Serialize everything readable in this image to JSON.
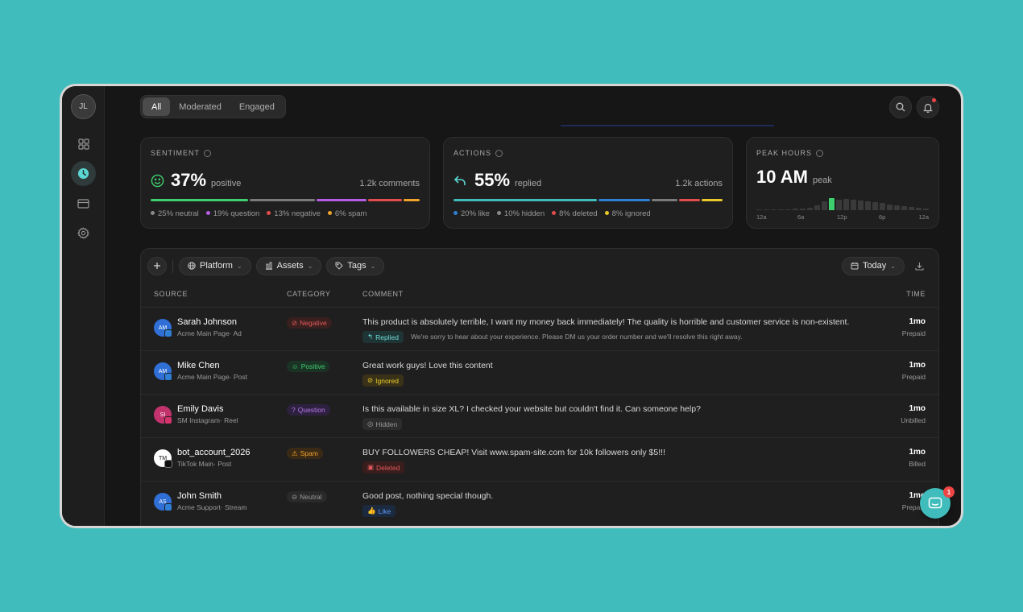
{
  "user": {
    "initials": "JL"
  },
  "sidebar": {
    "items": [
      {
        "icon": "grid-icon"
      },
      {
        "icon": "clock-icon",
        "active": true
      },
      {
        "icon": "card-icon"
      },
      {
        "icon": "gear-icon"
      }
    ]
  },
  "tabs": [
    {
      "label": "All",
      "active": true
    },
    {
      "label": "Moderated"
    },
    {
      "label": "Engaged"
    }
  ],
  "sentiment": {
    "title": "SENTIMENT",
    "value": "37%",
    "value_label": "positive",
    "count": "1.2k comments",
    "legend": [
      "25% neutral",
      "19% question",
      "13% negative",
      "6% spam"
    ]
  },
  "actions": {
    "title": "ACTIONS",
    "value": "55%",
    "value_label": "replied",
    "count": "1.2k actions",
    "legend": [
      "20% like",
      "10% hidden",
      "8% deleted",
      "8% ignored"
    ]
  },
  "peak": {
    "title": "PEAK HOURS",
    "value": "10 AM",
    "value_label": "peak",
    "axis": [
      "12a",
      "6a",
      "12p",
      "6p",
      "12a"
    ]
  },
  "toolbar": {
    "platform": "Platform",
    "assets": "Assets",
    "tags": "Tags",
    "date": "Today"
  },
  "table": {
    "headers": {
      "source": "SOURCE",
      "category": "CATEGORY",
      "comment": "COMMENT",
      "time": "TIME"
    },
    "rows": [
      {
        "initials": "AM",
        "name": "Sarah Johnson",
        "sub": "Acme Main Page· Ad",
        "category": "Negative",
        "comment": "This product is absolutely terrible, I want my money back immediately! The quality is horrible and customer service is non-existent.",
        "status": "Replied",
        "reply": "We're sorry to hear about your experience. Please DM us your order number and we'll resolve this right away.",
        "time": "1mo",
        "billing": "Prepaid"
      },
      {
        "initials": "AM",
        "name": "Mike Chen",
        "sub": "Acme Main Page· Post",
        "category": "Positive",
        "comment": "Great work guys! Love this content",
        "status": "Ignored",
        "reply": "",
        "time": "1mo",
        "billing": "Prepaid"
      },
      {
        "initials": "SI",
        "name": "Emily Davis",
        "sub": "SM Instagram· Reel",
        "category": "Question",
        "comment": "Is this available in size XL? I checked your website but couldn't find it. Can someone help?",
        "status": "Hidden",
        "reply": "",
        "time": "1mo",
        "billing": "Unbilled"
      },
      {
        "initials": "TM",
        "name": "bot_account_2026",
        "sub": "TikTok Main· Post",
        "category": "Spam",
        "comment": "BUY FOLLOWERS CHEAP! Visit www.spam-site.com for 10k followers only $5!!!",
        "status": "Deleted",
        "reply": "",
        "time": "1mo",
        "billing": "Billed"
      },
      {
        "initials": "AS",
        "name": "John Smith",
        "sub": "Acme Support· Stream",
        "category": "Neutral",
        "comment": "Good post, nothing special though.",
        "status": "Like",
        "reply": "",
        "time": "1mo",
        "billing": "Prepaid"
      }
    ]
  },
  "chat": {
    "badge": "1"
  }
}
